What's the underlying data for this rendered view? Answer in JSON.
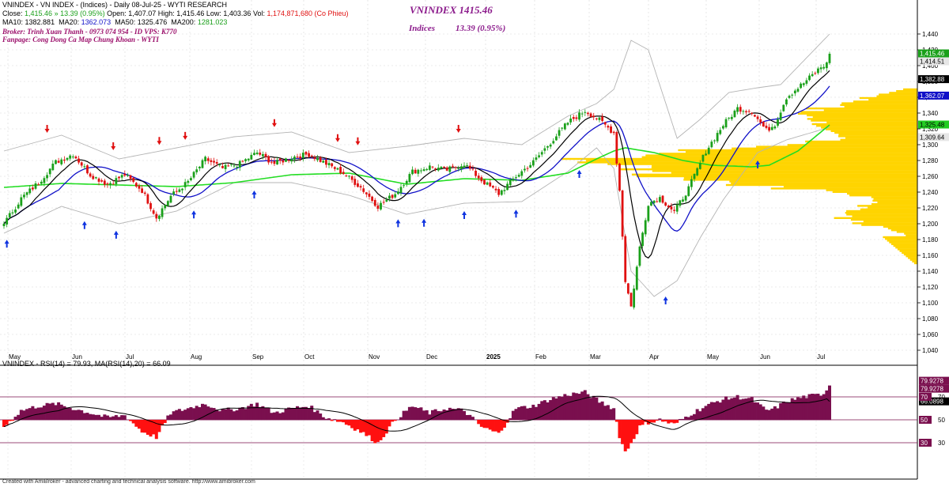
{
  "header": {
    "line1": {
      "title": "VNINDEX - VN INDEX - (Indices) - Daily 08-Jul-25 - WYTI RESEARCH",
      "close_label": "Close:",
      "close_value": "1,415.46",
      "change": "» 13.39 (0.95%)",
      "open_label": "Open:",
      "open_value": "1,407.07",
      "high_label": "High:",
      "high_value": "1,415.46",
      "low_label": "Low:",
      "low_value": "1,403.36",
      "vol_label": "Vol:",
      "vol_value": "1,174,871,680 (Co Phieu)"
    },
    "line2": {
      "ma10_label": "MA10:",
      "ma10_value": "1382.881",
      "ma20_label": "MA20:",
      "ma20_value": "1362.073",
      "ma50_label": "MA50:",
      "ma50_value": "1325.476",
      "ma200_label": "MA200:",
      "ma200_value": "1281.023"
    },
    "broker": "Broker: Trinh Xuan Thanh - 0973 074 954 - ID VPS: K770",
    "fanpage": "Fanpage: Cong Dong Ca Map Chung Khoan - WYTI",
    "big_title": "VNINDEX 1415.46",
    "big_sub_label": "Indices",
    "big_sub_value": "13.39 (0.95%)"
  },
  "rsi_header": "VNINDEX - RSI(14) = 79.93,  MA(RSI(14),20) = 66.09",
  "footer": "Created with AmiBroker - advanced charting and technical analysis software. http://www.amibroker.com",
  "colors": {
    "up": "#1aa01a",
    "down": "#e01010",
    "ma10": "#000000",
    "ma20": "#1010c8",
    "ma50": "#22dd22",
    "bollinger": "#b4b4b4",
    "volume_profile": "#ffd400",
    "rsi_fill": "#7a0f4e",
    "rsi_neg": "#ff1010",
    "signal_up": "#1034e0",
    "signal_down": "#e01010"
  },
  "chart_data": [
    {
      "type": "candlestick",
      "title": "VNINDEX 1415.46",
      "x_ticks": [
        "May",
        "Jun",
        "Jul",
        "Aug",
        "Sep",
        "Oct",
        "Nov",
        "Dec",
        "2025",
        "Feb",
        "Mar",
        "Apr",
        "May",
        "Jun",
        "Jul"
      ],
      "y_ticks": [
        1040,
        1060,
        1080,
        1100,
        1120,
        1140,
        1160,
        1180,
        1200,
        1220,
        1240,
        1260,
        1280,
        1300,
        1320,
        1340,
        1360,
        1380,
        1400,
        1420,
        1440
      ],
      "y_tick_labels": [
        "1,040",
        "1,060",
        "1,080",
        "1,100",
        "1,120",
        "1,140",
        "1,160",
        "1,180",
        "1,200",
        "1,220",
        "1,240",
        "1,260",
        "1,280",
        "1,300",
        "1,320",
        "1,340",
        "1,360",
        "1,380",
        "1,400",
        "1,420",
        "1,440"
      ],
      "ylim": [
        1030,
        1473
      ],
      "grid": true,
      "anchors": [
        [
          0,
          1200
        ],
        [
          6,
          1232
        ],
        [
          12,
          1252
        ],
        [
          18,
          1278
        ],
        [
          24,
          1288
        ],
        [
          30,
          1262
        ],
        [
          36,
          1250
        ],
        [
          42,
          1262
        ],
        [
          48,
          1242
        ],
        [
          53,
          1208
        ],
        [
          58,
          1235
        ],
        [
          64,
          1253
        ],
        [
          70,
          1282
        ],
        [
          76,
          1270
        ],
        [
          82,
          1276
        ],
        [
          88,
          1290
        ],
        [
          94,
          1276
        ],
        [
          100,
          1284
        ],
        [
          106,
          1288
        ],
        [
          112,
          1276
        ],
        [
          118,
          1264
        ],
        [
          124,
          1246
        ],
        [
          130,
          1222
        ],
        [
          136,
          1238
        ],
        [
          142,
          1266
        ],
        [
          148,
          1272
        ],
        [
          154,
          1268
        ],
        [
          160,
          1276
        ],
        [
          166,
          1255
        ],
        [
          172,
          1238
        ],
        [
          178,
          1260
        ],
        [
          184,
          1278
        ],
        [
          190,
          1303
        ],
        [
          196,
          1328
        ],
        [
          202,
          1343
        ],
        [
          207,
          1331
        ],
        [
          212,
          1315
        ],
        [
          214,
          1242
        ],
        [
          216,
          1128
        ],
        [
          218,
          1095
        ],
        [
          221,
          1170
        ],
        [
          224,
          1226
        ],
        [
          228,
          1233
        ],
        [
          233,
          1215
        ],
        [
          238,
          1245
        ],
        [
          244,
          1292
        ],
        [
          250,
          1325
        ],
        [
          255,
          1346
        ],
        [
          260,
          1342
        ],
        [
          265,
          1318
        ],
        [
          268,
          1326
        ],
        [
          272,
          1360
        ],
        [
          278,
          1378
        ],
        [
          284,
          1398
        ],
        [
          286,
          1402
        ],
        [
          287,
          1415
        ]
      ],
      "bollinger_upper_anchors": [
        [
          0,
          1292
        ],
        [
          20,
          1312
        ],
        [
          40,
          1282
        ],
        [
          60,
          1296
        ],
        [
          80,
          1310
        ],
        [
          100,
          1316
        ],
        [
          120,
          1290
        ],
        [
          140,
          1298
        ],
        [
          160,
          1308
        ],
        [
          180,
          1300
        ],
        [
          196,
          1336
        ],
        [
          206,
          1352
        ],
        [
          212,
          1370
        ],
        [
          218,
          1432
        ],
        [
          224,
          1420
        ],
        [
          234,
          1308
        ],
        [
          242,
          1332
        ],
        [
          252,
          1366
        ],
        [
          262,
          1372
        ],
        [
          270,
          1376
        ],
        [
          287,
          1440
        ]
      ],
      "bollinger_lower_anchors": [
        [
          0,
          1188
        ],
        [
          20,
          1222
        ],
        [
          40,
          1200
        ],
        [
          60,
          1216
        ],
        [
          80,
          1252
        ],
        [
          100,
          1252
        ],
        [
          120,
          1236
        ],
        [
          140,
          1212
        ],
        [
          160,
          1226
        ],
        [
          180,
          1228
        ],
        [
          196,
          1266
        ],
        [
          206,
          1296
        ],
        [
          212,
          1270
        ],
        [
          218,
          1140
        ],
        [
          226,
          1108
        ],
        [
          234,
          1128
        ],
        [
          242,
          1182
        ],
        [
          250,
          1230
        ],
        [
          262,
          1290
        ],
        [
          272,
          1306
        ],
        [
          287,
          1322
        ]
      ],
      "ma50_anchors": [
        [
          0,
          1246
        ],
        [
          20,
          1251
        ],
        [
          40,
          1249
        ],
        [
          60,
          1247
        ],
        [
          80,
          1252
        ],
        [
          100,
          1262
        ],
        [
          120,
          1264
        ],
        [
          140,
          1250
        ],
        [
          160,
          1257
        ],
        [
          180,
          1255
        ],
        [
          196,
          1264
        ],
        [
          206,
          1282
        ],
        [
          212,
          1292
        ],
        [
          216,
          1296
        ],
        [
          226,
          1290
        ],
        [
          236,
          1280
        ],
        [
          246,
          1274
        ],
        [
          260,
          1272
        ],
        [
          266,
          1274
        ],
        [
          276,
          1292
        ],
        [
          287,
          1325
        ]
      ],
      "buy_signals": [
        1,
        28,
        39,
        66,
        87,
        137,
        146,
        160,
        178,
        200,
        230,
        262
      ],
      "sell_signals": [
        15,
        38,
        54,
        63,
        94,
        116,
        123,
        158
      ],
      "last_price": 1415.46,
      "price_labels": [
        "1,415.46",
        "1,414.51",
        "1,382.88",
        "1,362.07",
        "1,325.48",
        "1,309.64"
      ],
      "volume_profile_peaks": [
        [
          1210,
          95
        ],
        [
          1255,
          205
        ],
        [
          1275,
          265
        ],
        [
          1290,
          180
        ],
        [
          1330,
          125
        ],
        [
          1350,
          70
        ]
      ]
    },
    {
      "type": "area",
      "title": "VNINDEX - RSI(14) = 79.93,  MA(RSI(14),20) = 66.09",
      "series": [
        {
          "name": "RSI(14)",
          "anchors": [
            [
              0,
              44
            ],
            [
              6,
              58
            ],
            [
              12,
              62
            ],
            [
              18,
              64
            ],
            [
              24,
              60
            ],
            [
              30,
              56
            ],
            [
              36,
              52
            ],
            [
              42,
              54
            ],
            [
              48,
              40
            ],
            [
              53,
              35
            ],
            [
              58,
              56
            ],
            [
              64,
              60
            ],
            [
              70,
              64
            ],
            [
              76,
              58
            ],
            [
              82,
              60
            ],
            [
              88,
              64
            ],
            [
              94,
              56
            ],
            [
              100,
              60
            ],
            [
              106,
              62
            ],
            [
              112,
              52
            ],
            [
              118,
              48
            ],
            [
              124,
              40
            ],
            [
              130,
              30
            ],
            [
              136,
              50
            ],
            [
              142,
              62
            ],
            [
              148,
              56
            ],
            [
              154,
              60
            ],
            [
              160,
              58
            ],
            [
              166,
              44
            ],
            [
              172,
              38
            ],
            [
              178,
              60
            ],
            [
              184,
              62
            ],
            [
              190,
              68
            ],
            [
              196,
              72
            ],
            [
              202,
              74
            ],
            [
              207,
              66
            ],
            [
              212,
              60
            ],
            [
              214,
              36
            ],
            [
              216,
              22
            ],
            [
              218,
              30
            ],
            [
              221,
              44
            ],
            [
              224,
              48
            ],
            [
              228,
              50
            ],
            [
              233,
              46
            ],
            [
              238,
              54
            ],
            [
              244,
              62
            ],
            [
              250,
              68
            ],
            [
              255,
              70
            ],
            [
              260,
              68
            ],
            [
              265,
              58
            ],
            [
              268,
              60
            ],
            [
              272,
              66
            ],
            [
              278,
              70
            ],
            [
              284,
              72
            ],
            [
              286,
              76
            ],
            [
              287,
              79.93
            ]
          ]
        },
        {
          "name": "MA(RSI(14),20)",
          "last_value": 66.09
        }
      ],
      "ylim": [
        25,
        88
      ],
      "levels": [
        30,
        50,
        70
      ],
      "level_labels": [
        "30",
        "50",
        "70"
      ],
      "right_labels": [
        "79.9278",
        "79.9278",
        "66.0898"
      ]
    }
  ]
}
